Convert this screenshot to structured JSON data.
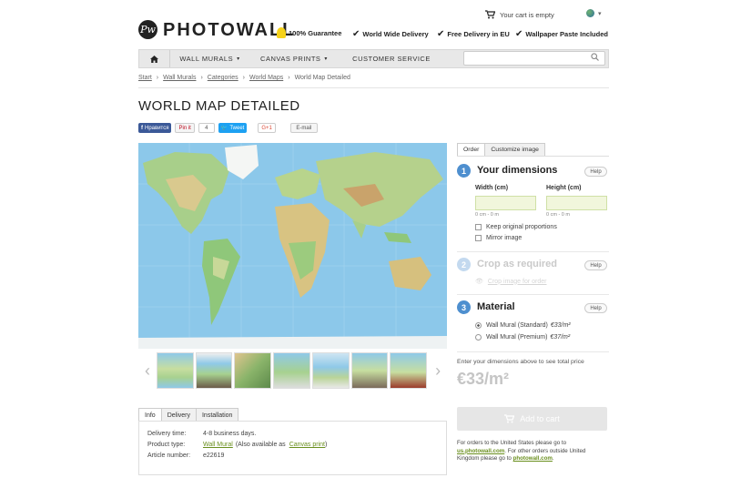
{
  "header": {
    "logo_mark": "Pw",
    "logo_text": "PHOTOWALL",
    "usps": [
      "100% Guarantee",
      "World Wide Delivery",
      "Free Delivery in EU",
      "Wallpaper Paste Included"
    ],
    "cart_text": "Your cart is empty"
  },
  "nav": {
    "items": [
      "WALL MURALS",
      "CANVAS PRINTS",
      "CUSTOMER SERVICE"
    ],
    "search_placeholder": ""
  },
  "breadcrumb": [
    "Start",
    "Wall Murals",
    "Categories",
    "World Maps",
    "World Map Detailed"
  ],
  "page_title": "WORLD MAP DETAILED",
  "share": {
    "facebook": "Нравится",
    "pinterest": "Pin it",
    "pin_count": "4",
    "twitter": "Tweet",
    "google": "G+1",
    "email": "E-mail"
  },
  "info_tabs": [
    "Info",
    "Delivery",
    "Installation"
  ],
  "info": {
    "delivery_label": "Delivery time:",
    "delivery_value": "4-8 business days.",
    "product_label": "Product type:",
    "product_value": "Wall Mural",
    "also_prefix": "(Also available as",
    "also_link": "Canvas print",
    "also_suffix": ")",
    "article_label": "Article number:",
    "article_value": "e22619"
  },
  "panel": {
    "tabs": [
      "Order",
      "Customize image"
    ],
    "step1": {
      "num": "1",
      "title": "Your dimensions",
      "help": "Help"
    },
    "width_label": "Width  (cm)",
    "height_label": "Height  (cm)",
    "width_hint": "0 cm - 0 m",
    "height_hint": "0 cm - 0 m",
    "keep_proportions": "Keep original proportions",
    "mirror": "Mirror image",
    "step2": {
      "num": "2",
      "title": "Crop as required",
      "help": "Help",
      "sub": "Crop image for order"
    },
    "step3": {
      "num": "3",
      "title": "Material",
      "help": "Help"
    },
    "materials": [
      {
        "label": "Wall Mural (Standard)",
        "price": "€33/m²",
        "selected": true
      },
      {
        "label": "Wall Mural (Premium)",
        "price": "€37/m²",
        "selected": false
      }
    ],
    "price_note": "Enter your dimensions above to see total price",
    "price": "€33/m²",
    "add_to_cart": "Add to cart",
    "order_note_1": "For orders to the United States please go to",
    "us_link": "us.photowall.com",
    "order_note_2": ". For other orders outside United Kingdom please go to",
    "intl_link": "photowall.com",
    "order_note_3": "."
  },
  "colors": {
    "accent_blue": "#4e8fcf",
    "link_green": "#6a8f1e"
  }
}
